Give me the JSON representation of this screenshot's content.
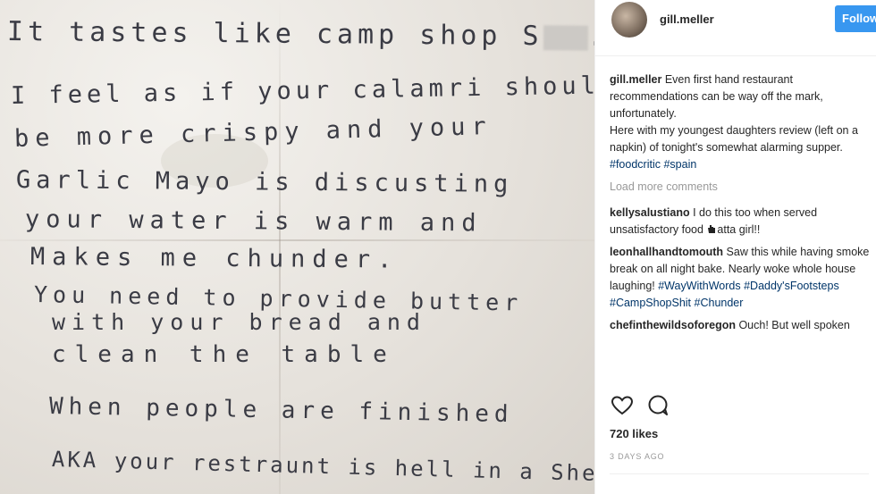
{
  "photo": {
    "lines": [
      "It tastes like camp shop S",
      "I feel as if your calamri should",
      "be more crispy and your",
      "Garlic Mayo is discusting",
      "your water is warm and",
      "Makes me chunder.",
      "You need to provide butter",
      "with your bread and",
      "clean the table",
      "When people are finished",
      "AKA your restraunt is hell in a Shell"
    ],
    "line1_end": "."
  },
  "header": {
    "username": "gill.meller",
    "follow_label": "Follow"
  },
  "caption": {
    "user": "gill.meller",
    "text": " Even first hand restaurant recommendations can be way off the mark, unfortunately.",
    "text2": "Here with my youngest daughters review (left on a napkin) of tonight's somewhat alarming supper. ",
    "tags": [
      "#foodcritic",
      "#spain"
    ]
  },
  "load_more": "Load more comments",
  "comments": [
    {
      "user": "kellysalustiano",
      "text": " I do this too when served unsatisfactory food",
      "text_after": "atta girl!!"
    },
    {
      "user": "leonhallhandtomouth",
      "text": " Saw this while having smoke break on all night bake. Nearly woke whole house laughing! ",
      "tags": [
        "#WayWithWords",
        "#Daddy'sFootsteps",
        "#CampShopShit",
        "#Chunder"
      ]
    },
    {
      "user": "chefinthewildsoforegon",
      "text": " Ouch! But well spoken"
    }
  ],
  "likes": "720 likes",
  "time": "3 DAYS AGO",
  "colors": {
    "accent": "#3897f0",
    "hashtag": "#003569",
    "muted": "#999999"
  },
  "icons": [
    "heart-icon",
    "comment-icon",
    "hand-icon"
  ]
}
